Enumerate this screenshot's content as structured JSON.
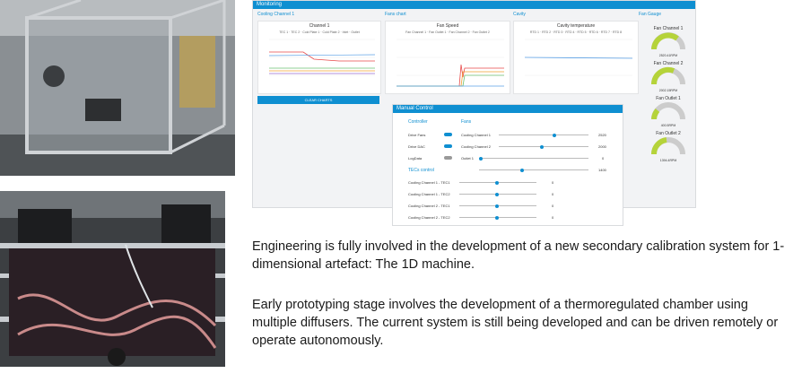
{
  "dashboard": {
    "header": "Monitoring",
    "groups": [
      "Cooling Channel 1",
      "Fans chart",
      "Cavity",
      "Fan Gauge"
    ],
    "charts": [
      {
        "title": "Channel 1",
        "legend": "TEC 1 · TEC 2 · Cold Plate 1 · Cold Plate 2 · Inlet · Outlet"
      },
      {
        "title": "Fan Speed",
        "legend": "Fan Channel 1 · Fan Outlet 1 · Fan Channel 2 · Fan Outlet 2"
      },
      {
        "title": "Cavity temperature",
        "legend": "RTD 1 · RTD 2 · RTD 3 · RTD 4 · RTD 5 · RTD 6 · RTD 7 · RTD 8"
      }
    ],
    "clear_label": "CLEAR CHARTS",
    "gauges": [
      {
        "title": "Fan Channel 1",
        "value": "2520.41RPM"
      },
      {
        "title": "Fan Channel 2",
        "value": "2002.15RPM"
      },
      {
        "title": "Fan Outlet 1",
        "value": "400.5RPM"
      },
      {
        "title": "Fan Outlet 2",
        "value": "1394.4RPM"
      }
    ],
    "manual": {
      "header": "Manual Control",
      "controller_label": "Controller",
      "fans_label": "Fans",
      "tecs_label": "TECs control",
      "toggles": [
        "Drive Fans",
        "Drive DAC",
        "LogData"
      ],
      "fans": [
        {
          "label": "Cooling Channel 1",
          "value": "2520"
        },
        {
          "label": "Cooling Channel 2",
          "value": "2000"
        },
        {
          "label": "Outlet 1",
          "value": "0"
        },
        {
          "label": "",
          "value": "1400"
        }
      ],
      "tecs": [
        {
          "label": "Cooling Channel 1 - TEC1",
          "value": "0"
        },
        {
          "label": "Cooling Channel 1 - TEC2",
          "value": "0"
        },
        {
          "label": "Cooling Channel 2 - TEC1",
          "value": "0"
        },
        {
          "label": "Cooling Channel 2 - TEC2",
          "value": "0"
        }
      ]
    }
  },
  "caption": {
    "p1": "Engineering is fully involved in the development of a new secondary calibration system for 1-dimensional artefact: The 1D machine.",
    "p2": "Early prototyping stage involves the development of a thermoregulated chamber using multiple diffusers. The current system is still being developed and can be driven remotely or operate autonomously."
  },
  "colors": {
    "accent": "#0f8fd1",
    "gauge_fill": "#b5d33a"
  }
}
